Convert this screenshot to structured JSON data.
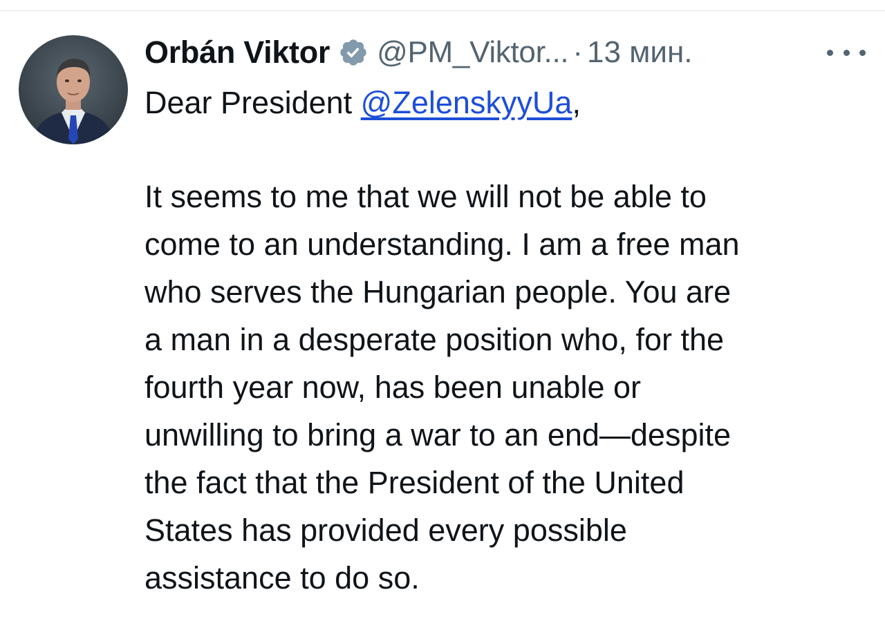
{
  "post": {
    "author_name": "Orbán Viktor",
    "handle": "@PM_Viktor...",
    "separator": "·",
    "time": "13 мин.",
    "greeting_prefix": "Dear President ",
    "mention": "@ZelenskyyUa",
    "greeting_suffix": ",",
    "body_lines": [
      "It seems to me that we will not be able to",
      "come to an understanding. I am a free man",
      "who serves the Hungarian people. You are",
      "a man in a desperate position who, for the",
      "fourth year now, has been unable or",
      "unwilling to bring a war to an end—despite",
      "the fact that the President of the United",
      "States has provided every possible",
      "assistance to do so."
    ]
  },
  "icons": {
    "verified": "verified-badge-icon",
    "more": "more-options-icon"
  },
  "colors": {
    "text": "#0f1419",
    "secondary": "#536471",
    "mention": "#1d4ed8",
    "verified_badge": "#829aab"
  }
}
